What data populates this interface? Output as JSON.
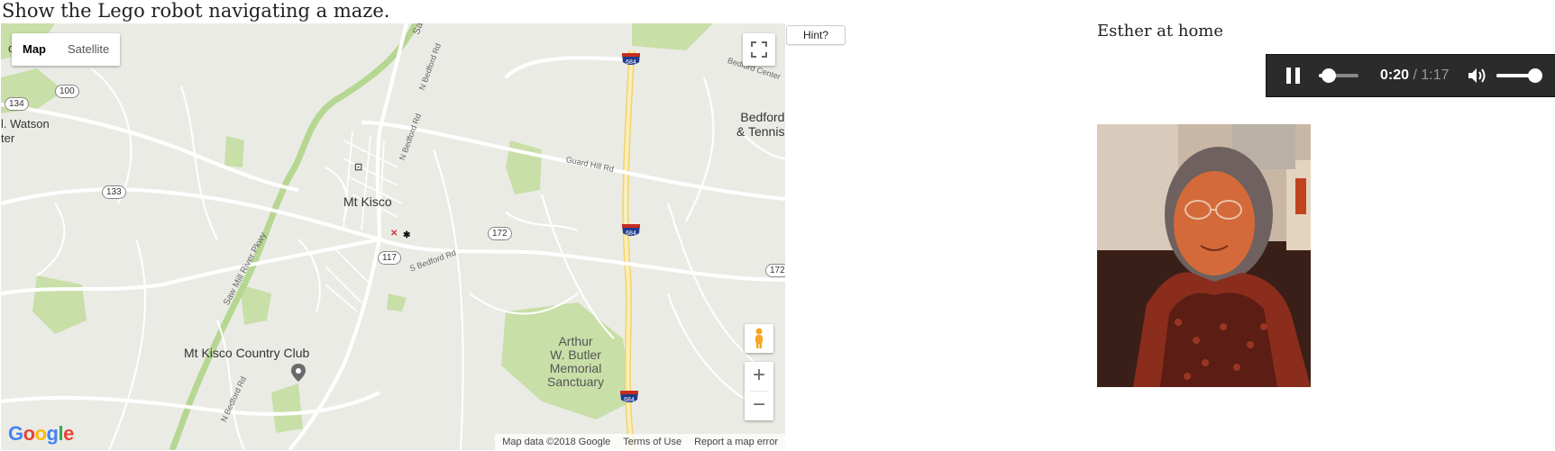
{
  "page": {
    "title": "Show the Lego robot navigating a maze."
  },
  "map": {
    "type_controls": {
      "map": "Map",
      "satellite": "Satellite",
      "active": "Map"
    },
    "labels": {
      "mt_kisco": "Mt Kisco",
      "bedford_tennis": "Bedford\n& Tennis",
      "country_club": "Mt Kisco Country Club",
      "arthur_butler": "Arthur\nW. Butler\nMemorial\nSanctuary",
      "watson": "l. Watson",
      "ter": "ter",
      "chawan": "chawan",
      "saw_mill": "Saw Mill River Pkwy",
      "n_bedford_rd_1": "N Bedford Rd",
      "n_bedford_rd_2": "N Bedford Rd",
      "n_bedford_rd_3": "N Bedford Rd",
      "s_bedford_rd": "S Bedford Rd",
      "guard_hill_rd": "Guard Hill Rd",
      "bedford_center": "Bedford Center",
      "sa": "Sa"
    },
    "route_shields": [
      "134",
      "100",
      "133",
      "117",
      "172",
      "172"
    ],
    "interstate_shields": [
      "684",
      "684",
      "684"
    ],
    "attribution": {
      "data": "Map data ©2018 Google",
      "terms": "Terms of Use",
      "report": "Report a map error"
    },
    "logo": "Google",
    "zoom_in": "+",
    "zoom_out": "−"
  },
  "hint": {
    "label": "Hint?"
  },
  "audio": {
    "caption": "Esther at home",
    "current_time": "0:20",
    "separator": " / ",
    "duration": "1:17",
    "progress": 0.26,
    "volume": 0.9
  },
  "colors": {
    "map_bg": "#ebebe6",
    "park": "#c8dfa8",
    "road": "#ffffff",
    "highway": "#f7e6a6",
    "player_bg": "#2b2b2b"
  }
}
